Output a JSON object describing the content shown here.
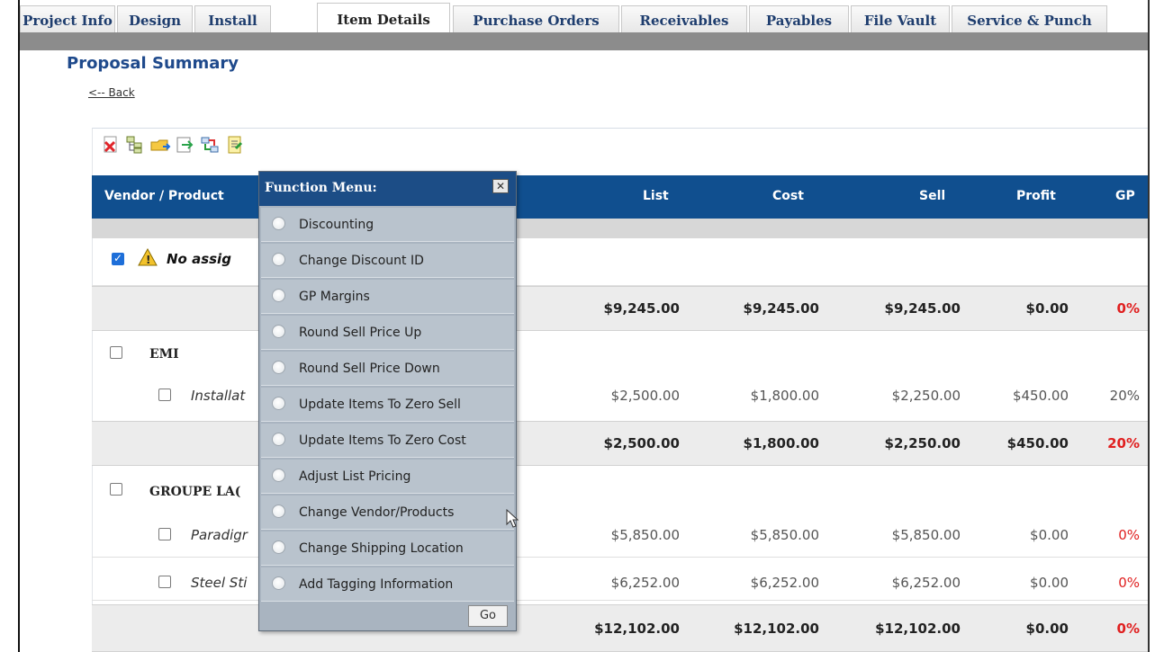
{
  "tabs": [
    "Project Info",
    "Design",
    "Install",
    "Item Details",
    "Purchase Orders",
    "Receivables",
    "Payables",
    "File Vault",
    "Service & Punch"
  ],
  "active_tab": "Item Details",
  "page": {
    "title": "Proposal Summary",
    "back_label": "<-- Back"
  },
  "toolbar": {
    "icons": [
      "delete-icon",
      "tree-icon",
      "folder-icon",
      "export-icon",
      "transfer-icon",
      "report-icon"
    ]
  },
  "table": {
    "headers": {
      "vendor_product": "Vendor / Product",
      "list": "List",
      "cost": "Cost",
      "sell": "Sell",
      "profit": "Profit",
      "gp": "GP"
    },
    "no_assign": {
      "label": "No assig",
      "checked": true
    },
    "no_assign_totals": {
      "list": "$9,245.00",
      "cost": "$9,245.00",
      "sell": "$9,245.00",
      "profit": "$0.00",
      "gp": "0%"
    },
    "vendors": [
      {
        "name": "EMI",
        "items": [
          {
            "name": "Installat",
            "list": "$2,500.00",
            "cost": "$1,800.00",
            "sell": "$2,250.00",
            "profit": "$450.00",
            "gp": "20%"
          }
        ],
        "totals": {
          "list": "$2,500.00",
          "cost": "$1,800.00",
          "sell": "$2,250.00",
          "profit": "$450.00",
          "gp": "20%"
        }
      },
      {
        "name": "GROUPE LA(",
        "items": [
          {
            "name": "Paradigr",
            "list": "$5,850.00",
            "cost": "$5,850.00",
            "sell": "$5,850.00",
            "profit": "$0.00",
            "gp": "0%"
          },
          {
            "name": "Steel Sti",
            "list": "$6,252.00",
            "cost": "$6,252.00",
            "sell": "$6,252.00",
            "profit": "$0.00",
            "gp": "0%"
          }
        ],
        "totals": {
          "list": "$12,102.00",
          "cost": "$12,102.00",
          "sell": "$12,102.00",
          "profit": "$0.00",
          "gp": "0%"
        }
      }
    ]
  },
  "function_menu": {
    "title": "Function Menu:",
    "close_label": "✕",
    "options": [
      "Discounting",
      "Change Discount ID",
      "GP Margins",
      "Round Sell Price Up",
      "Round Sell Price Down",
      "Update Items To Zero Sell",
      "Update Items To Zero Cost",
      "Adjust List Pricing",
      "Change Vendor/Products",
      "Change Shipping Location",
      "Add Tagging Information"
    ],
    "go_label": "Go"
  },
  "colors": {
    "header_blue": "#104f8f",
    "title_blue": "#1f4a8c",
    "menu_bg": "#b9c3cd",
    "negative_red": "#e02020"
  }
}
